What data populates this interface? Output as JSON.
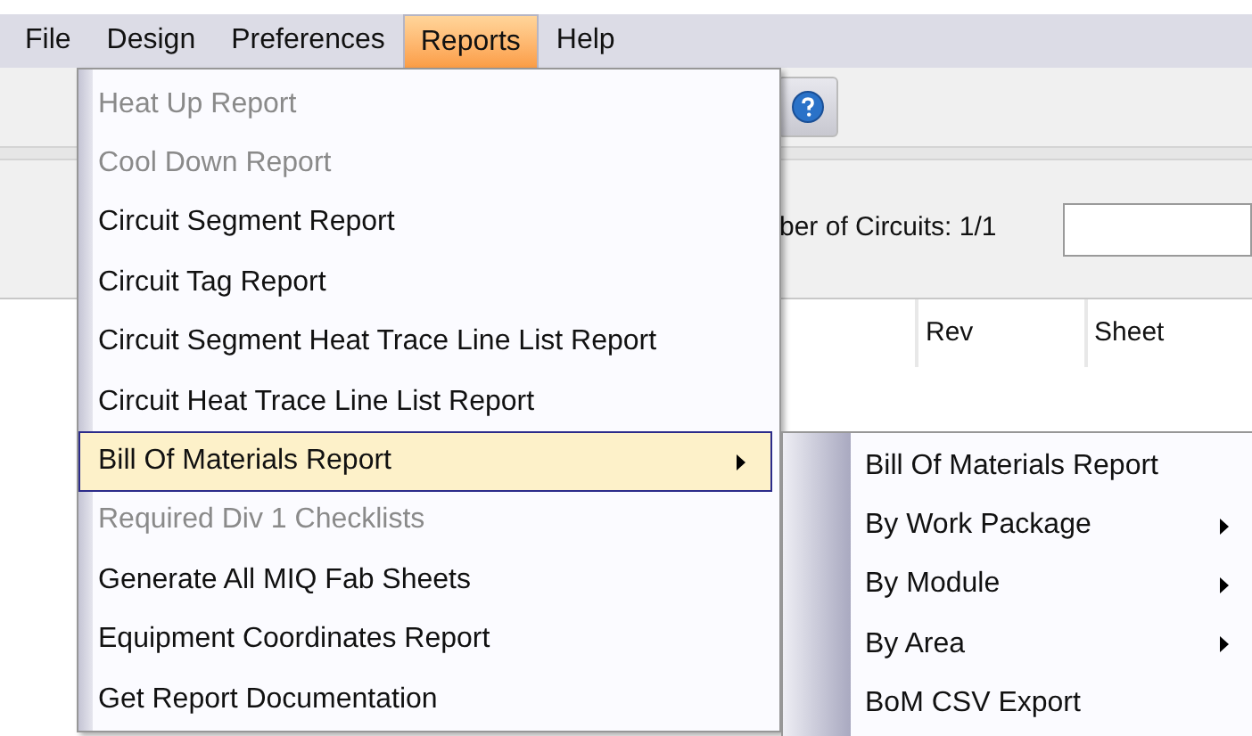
{
  "menubar": [
    {
      "label": "File",
      "selected": false
    },
    {
      "label": "Design",
      "selected": false
    },
    {
      "label": "Preferences",
      "selected": false
    },
    {
      "label": "Reports",
      "selected": true
    },
    {
      "label": "Help",
      "selected": false
    }
  ],
  "background": {
    "circuit_count": "ber of Circuits: 1/1",
    "columns": [
      "Rev",
      "Sheet"
    ]
  },
  "reports_menu": {
    "items": [
      {
        "label": "Heat Up Report",
        "disabled": true,
        "selected": false,
        "has_submenu": false
      },
      {
        "label": "Cool Down Report",
        "disabled": true,
        "selected": false,
        "has_submenu": false
      },
      {
        "label": "Circuit Segment Report",
        "disabled": false,
        "selected": false,
        "has_submenu": false
      },
      {
        "label": "Circuit Tag Report",
        "disabled": false,
        "selected": false,
        "has_submenu": false
      },
      {
        "label": "Circuit Segment Heat Trace Line List Report",
        "disabled": false,
        "selected": false,
        "has_submenu": false
      },
      {
        "label": "Circuit Heat Trace Line List Report",
        "disabled": false,
        "selected": false,
        "has_submenu": false
      },
      {
        "label": "Bill Of Materials Report",
        "disabled": false,
        "selected": true,
        "has_submenu": true
      },
      {
        "label": "Required Div 1 Checklists",
        "disabled": true,
        "selected": false,
        "has_submenu": false
      },
      {
        "label": "Generate All MIQ Fab Sheets",
        "disabled": false,
        "selected": false,
        "has_submenu": false
      },
      {
        "label": "Equipment Coordinates Report",
        "disabled": false,
        "selected": false,
        "has_submenu": false
      },
      {
        "label": "Get Report Documentation",
        "disabled": false,
        "selected": false,
        "has_submenu": false
      }
    ]
  },
  "submenu": {
    "items": [
      {
        "label": "Bill Of Materials Report",
        "has_submenu": false
      },
      {
        "label": "By Work Package",
        "has_submenu": true
      },
      {
        "label": "By Module",
        "has_submenu": true
      },
      {
        "label": "By Area",
        "has_submenu": true
      },
      {
        "label": "BoM CSV Export",
        "has_submenu": false
      }
    ]
  }
}
